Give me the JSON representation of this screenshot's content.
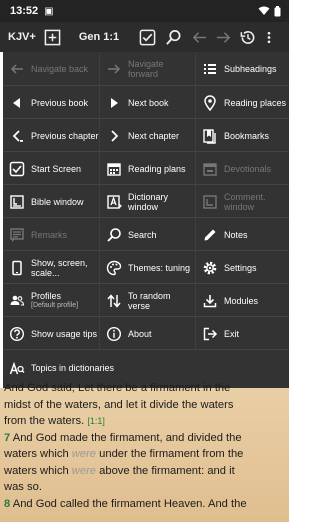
{
  "status_bar": {
    "time": "13:52",
    "notif": "▣"
  },
  "toolbar": {
    "version": "KJV+",
    "book": "Gen 1:1"
  },
  "menu": {
    "rows": [
      [
        {
          "label": "Navigate back",
          "icon": "arrow-back-icon",
          "disabled": true
        },
        {
          "label": "Navigate forward",
          "icon": "arrow-forward-icon",
          "disabled": true
        },
        {
          "label": "Subheadings",
          "icon": "subheadings-icon",
          "disabled": false
        }
      ],
      [
        {
          "label": "Previous book",
          "icon": "previous-book-icon",
          "disabled": false
        },
        {
          "label": "Next book",
          "icon": "next-book-icon",
          "disabled": false
        },
        {
          "label": "Reading places",
          "icon": "location-pin-icon",
          "disabled": false
        }
      ],
      [
        {
          "label": "Previous chapter",
          "icon": "chevron-left-icon",
          "disabled": false
        },
        {
          "label": "Next chapter",
          "icon": "chevron-right-icon",
          "disabled": false
        },
        {
          "label": "Bookmarks",
          "icon": "bookmarks-icon",
          "disabled": false
        }
      ],
      [
        {
          "label": "Start Screen",
          "icon": "checkbox-icon",
          "disabled": false
        },
        {
          "label": "Reading plans",
          "icon": "calendar-icon",
          "disabled": false
        },
        {
          "label": "Devotionals",
          "icon": "devotionals-icon",
          "disabled": true
        }
      ],
      [
        {
          "label": "Bible window",
          "icon": "bible-window-icon",
          "disabled": false
        },
        {
          "label": "Dictionary window",
          "icon": "dictionary-icon",
          "disabled": false
        },
        {
          "label": "Comment. window",
          "icon": "comment-window-icon",
          "disabled": true
        }
      ],
      [
        {
          "label": "Remarks",
          "icon": "remarks-icon",
          "disabled": true
        },
        {
          "label": "Search",
          "icon": "search-icon",
          "disabled": false
        },
        {
          "label": "Notes",
          "icon": "pencil-icon",
          "disabled": false
        }
      ],
      [
        {
          "label": "Show, screen, scale...",
          "icon": "phone-icon",
          "disabled": false
        },
        {
          "label": "Themes: tuning",
          "icon": "palette-icon",
          "disabled": false
        },
        {
          "label": "Settings",
          "icon": "gear-icon",
          "disabled": false
        }
      ],
      [
        {
          "label": "Profiles",
          "sub": "[Default profile]",
          "icon": "profiles-icon",
          "disabled": false
        },
        {
          "label": "To random verse",
          "icon": "random-icon",
          "disabled": false
        },
        {
          "label": "Modules",
          "icon": "download-icon",
          "disabled": false
        }
      ],
      [
        {
          "label": "Show usage tips",
          "icon": "help-icon",
          "disabled": false
        },
        {
          "label": "About",
          "icon": "info-icon",
          "disabled": false
        },
        {
          "label": "Exit",
          "icon": "exit-icon",
          "disabled": false
        }
      ]
    ],
    "topics": {
      "label": "Topics in dictionaries",
      "icon": "topics-icon"
    }
  },
  "bible": {
    "line0": "And God said, Let there be a firmament in the",
    "line1": "midst of the waters, and let it divide the waters",
    "line2_a": "from the waters.",
    "line2_ref": "[1:1]",
    "v7_num": "7",
    "v7_a": "And God made the firmament, and divided the",
    "v7_b_a": "waters which",
    "v7_b_it": "were",
    "v7_b_b": "under the firmament from the",
    "v7_c_a": "waters which",
    "v7_c_it": "were",
    "v7_c_b": "above the firmament: and it",
    "v7_d": "was so.",
    "v8_num": "8",
    "v8_a": "And God called the firmament Heaven. And the"
  }
}
